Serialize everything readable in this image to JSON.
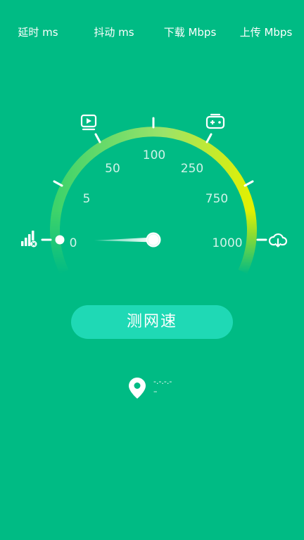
{
  "stats": {
    "latency_label": "延时 ms",
    "jitter_label": "抖动 ms",
    "download_label": "下载 Mbps",
    "upload_label": "上传 Mbps"
  },
  "gauge": {
    "scale_labels": [
      "0",
      "5",
      "50",
      "100",
      "250",
      "750",
      "1000"
    ],
    "needle_value": "0",
    "arc_colors": [
      "#3ED36A",
      "#E2F000"
    ],
    "icons": [
      "signal-icon",
      "video-icon",
      "game-icon",
      "cloud-download-icon"
    ]
  },
  "actions": {
    "test_button_label": "测网速"
  },
  "location": {
    "line1": "-.-.-.-",
    "line2": "–",
    "icon": "location-pin-icon"
  }
}
